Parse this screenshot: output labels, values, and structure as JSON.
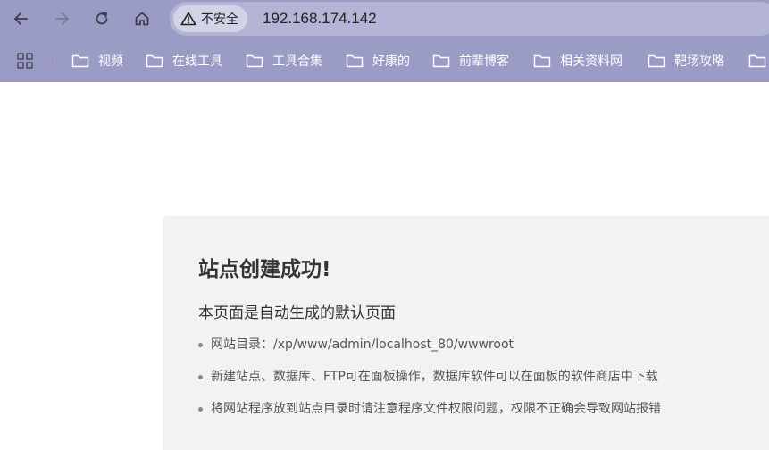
{
  "browser": {
    "security_label": "不安全",
    "url": "192.168.174.142",
    "chrome_color": "#9b9cc6"
  },
  "bookmarks": [
    {
      "label": "视频",
      "icon": "folder-icon"
    },
    {
      "label": "在线工具",
      "icon": "folder-icon"
    },
    {
      "label": "工具合集",
      "icon": "folder-icon"
    },
    {
      "label": "好康的",
      "icon": "folder-icon"
    },
    {
      "label": "前辈博客",
      "icon": "folder-icon"
    },
    {
      "label": "相关资料网",
      "icon": "folder-icon"
    },
    {
      "label": "靶场攻略",
      "icon": "folder-icon"
    }
  ],
  "page": {
    "title": "站点创建成功!",
    "subtitle": "本页面是自动生成的默认页面",
    "items": [
      "网站目录：/xp/www/admin/localhost_80/wwwroot",
      "新建站点、数据库、FTP可在面板操作，数据库软件可以在面板的软件商店中下载",
      "将网站程序放到站点目录时请注意程序文件权限问题，权限不正确会导致网站报错"
    ]
  }
}
